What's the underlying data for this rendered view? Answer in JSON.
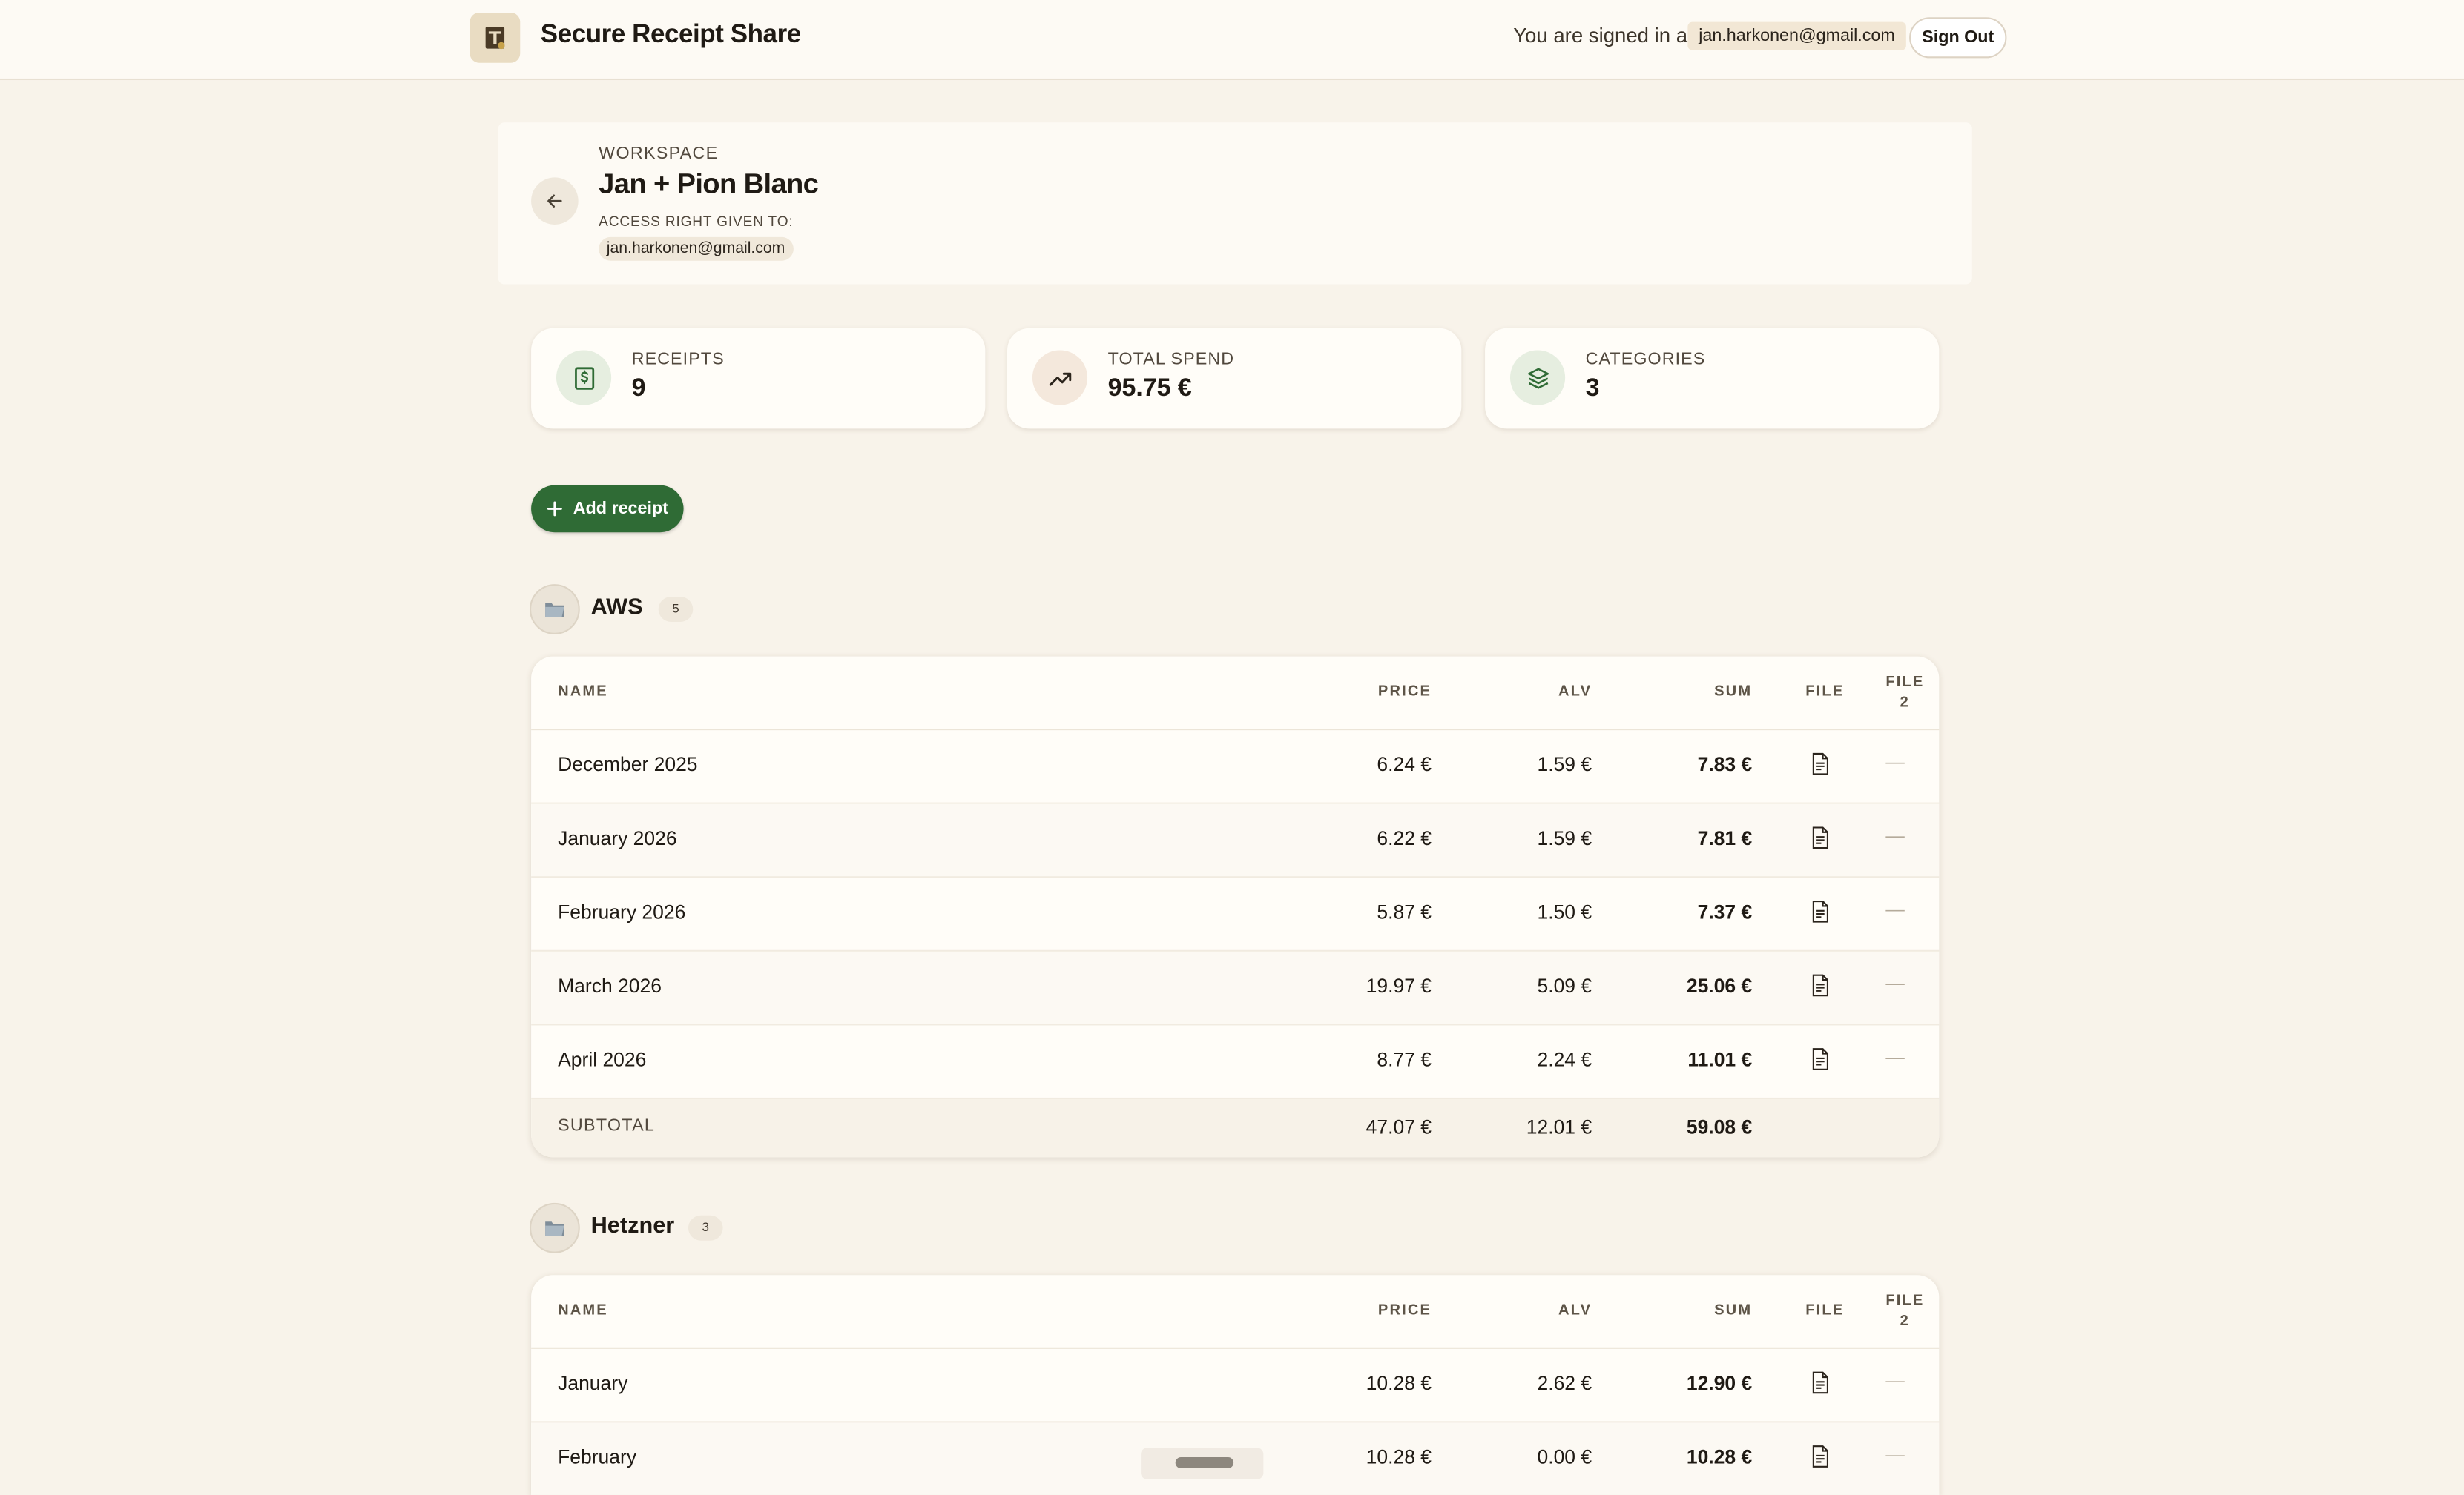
{
  "header": {
    "app_title": "Secure Receipt Share",
    "signed_in_text": "You are signed in as",
    "user_email": "jan.harkonen@gmail.com",
    "sign_out_label": "Sign Out",
    "logo_icon": "receipt-logo-icon"
  },
  "workspace": {
    "label": "WORKSPACE",
    "name": "Jan + Pion Blanc",
    "access_label": "ACCESS RIGHT GIVEN TO:",
    "access_email": "jan.harkonen@gmail.com",
    "back_icon": "arrow-left-icon"
  },
  "stats": [
    {
      "label": "RECEIPTS",
      "value": "9",
      "icon": "dollar-receipt-icon",
      "color": "#2f6b35"
    },
    {
      "label": "TOTAL SPEND",
      "value": "95.75 €",
      "icon": "trending-up-icon",
      "color": "#2b241c"
    },
    {
      "label": "CATEGORIES",
      "value": "3",
      "icon": "layers-icon",
      "color": "#2f6b35"
    }
  ],
  "add_receipt_label": "Add receipt",
  "columns": {
    "name": "NAME",
    "price": "PRICE",
    "alv": "ALV",
    "sum": "SUM",
    "file": "FILE",
    "file2_line1": "FILE",
    "file2_line2": "2"
  },
  "groups": [
    {
      "name": "AWS",
      "count": "5",
      "rows": [
        {
          "name": "December 2025",
          "price": "6.24 €",
          "alv": "1.59 €",
          "sum": "7.83 €",
          "file2": "—"
        },
        {
          "name": "January 2026",
          "price": "6.22 €",
          "alv": "1.59 €",
          "sum": "7.81 €",
          "file2": "—"
        },
        {
          "name": "February 2026",
          "price": "5.87 €",
          "alv": "1.50 €",
          "sum": "7.37 €",
          "file2": "—"
        },
        {
          "name": "March 2026",
          "price": "19.97 €",
          "alv": "5.09 €",
          "sum": "25.06 €",
          "file2": "—"
        },
        {
          "name": "April 2026",
          "price": "8.77 €",
          "alv": "2.24 €",
          "sum": "11.01 €",
          "file2": "—"
        }
      ],
      "subtotal": {
        "label": "SUBTOTAL",
        "price": "47.07 €",
        "alv": "12.01 €",
        "sum": "59.08 €"
      }
    },
    {
      "name": "Hetzner",
      "count": "3",
      "rows": [
        {
          "name": "January",
          "price": "10.28 €",
          "alv": "2.62 €",
          "sum": "12.90 €",
          "file2": "—"
        },
        {
          "name": "February",
          "price": "10.28 €",
          "alv": "0.00 €",
          "sum": "10.28 €",
          "file2": "—"
        }
      ]
    }
  ],
  "colors": {
    "accent_green": "#2f6b35",
    "background": "#f8f3ea",
    "card": "#fffdf8"
  }
}
